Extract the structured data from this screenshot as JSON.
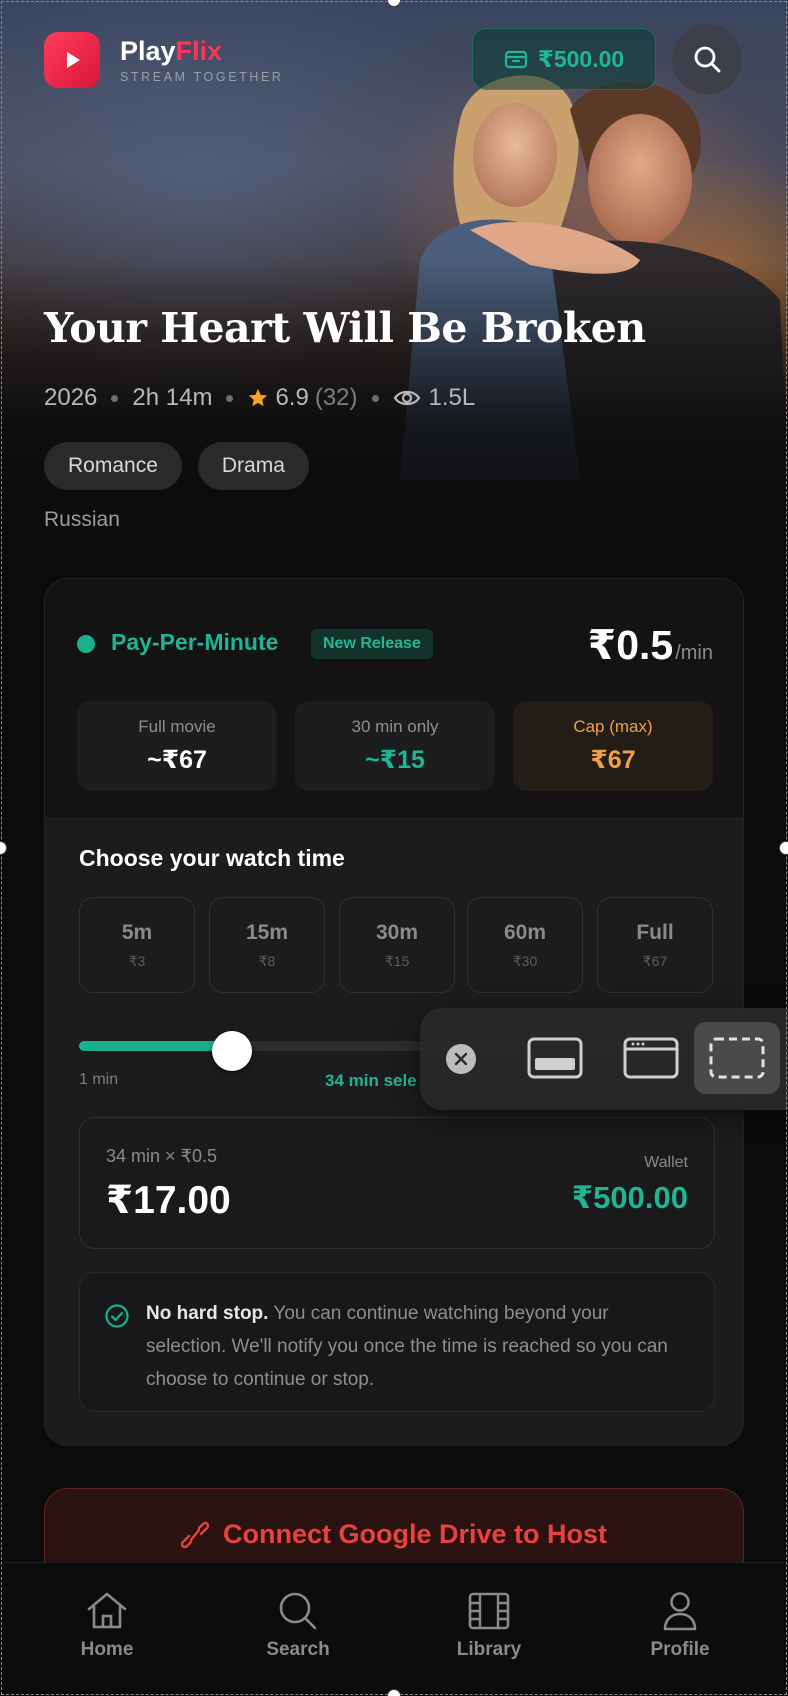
{
  "header": {
    "brand_play": "Play",
    "brand_flix": "Flix",
    "tagline": "STREAM TOGETHER",
    "wallet_balance": "₹500.00"
  },
  "movie": {
    "title": "Your Heart Will Be Broken",
    "year": "2026",
    "duration": "2h 14m",
    "rating": "6.9",
    "rating_count": "(32)",
    "views": "1.5L",
    "genres": [
      "Romance",
      "Drama"
    ],
    "language": "Russian"
  },
  "ppm": {
    "label": "Pay-Per-Minute",
    "badge": "New Release",
    "price": "₹0.5",
    "price_unit": "/min",
    "stats": [
      {
        "label": "Full movie",
        "value": "~₹67"
      },
      {
        "label": "30 min only",
        "value": "~₹15"
      },
      {
        "label": "Cap (max)",
        "value": "₹67"
      }
    ],
    "choose_title": "Choose your watch time",
    "options": [
      {
        "minutes": "5m",
        "cost": "₹3"
      },
      {
        "minutes": "15m",
        "cost": "₹8"
      },
      {
        "minutes": "30m",
        "cost": "₹15"
      },
      {
        "minutes": "60m",
        "cost": "₹30"
      },
      {
        "minutes": "Full",
        "cost": "₹67"
      }
    ],
    "slider": {
      "min_label": "1 min",
      "selected_label": "34 min sele",
      "value_fraction": 0.24
    },
    "summary": {
      "formula": "34 min × ₹0.5",
      "total": "₹17.00",
      "wallet_label": "Wallet",
      "wallet_value": "₹500.00"
    },
    "note": {
      "bold": "No hard stop.",
      "text": " You can continue watching beyond your selection. We'll notify you once the time is reached so you can choose to continue or stop."
    }
  },
  "drive_button": {
    "label": "Connect Google Drive to Host"
  },
  "bottom_nav": [
    {
      "label": "Home",
      "icon": "home-icon"
    },
    {
      "label": "Search",
      "icon": "search-icon"
    },
    {
      "label": "Library",
      "icon": "film-icon"
    },
    {
      "label": "Profile",
      "icon": "profile-icon"
    }
  ],
  "capture_toolbar": {
    "icons": [
      "close-icon",
      "capture-window-icon",
      "capture-browser-icon",
      "capture-region-icon"
    ],
    "active": "capture-region-icon"
  },
  "colors": {
    "accent": "#18b08e",
    "brand": "#ff3556",
    "cap": "#f0a043",
    "drive": "#e8413e"
  }
}
